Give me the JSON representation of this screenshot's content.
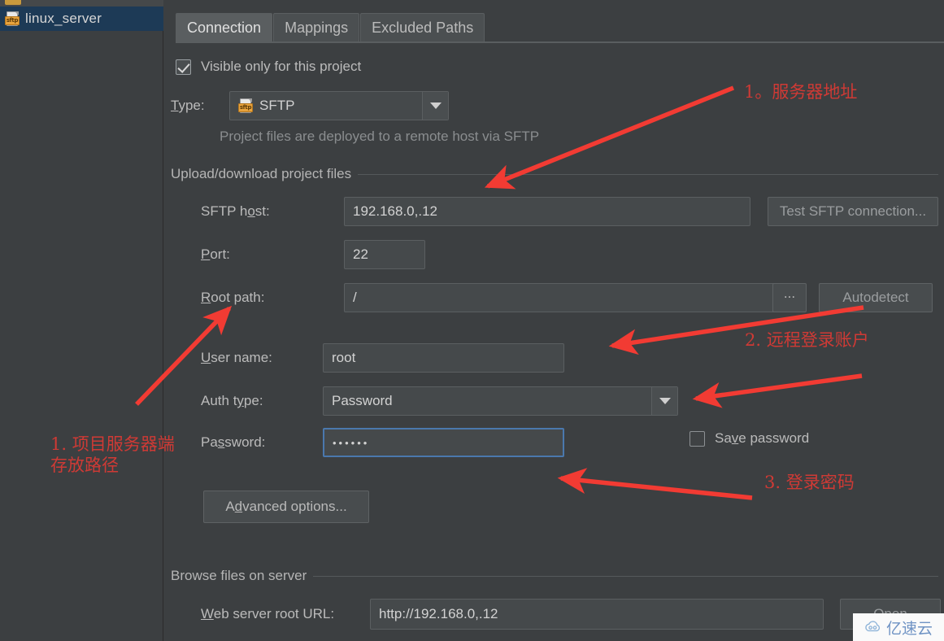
{
  "sidebar": {
    "server_item": {
      "label": "linux_server",
      "icon": "sftp-file-icon",
      "selected": true
    }
  },
  "tabs": [
    {
      "label": "Connection",
      "active": true
    },
    {
      "label": "Mappings",
      "active": false
    },
    {
      "label": "Excluded Paths",
      "active": false
    }
  ],
  "form": {
    "visible_only_checkbox": {
      "label": "Visible only for this project",
      "checked": true
    },
    "type": {
      "label": "Type:",
      "value": "SFTP",
      "icon": "sftp-file-icon"
    },
    "type_hint": "Project files are deployed to a remote host via SFTP",
    "upload_group_title": "Upload/download project files",
    "sftp_host": {
      "label": "SFTP host:",
      "value": "192.168.0,.12"
    },
    "test_connection_button": "Test SFTP connection...",
    "port": {
      "label": "Port:",
      "value": "22"
    },
    "root_path": {
      "label": "Root path:",
      "value": "/"
    },
    "browse_button": "...",
    "autodetect_button": "Autodetect",
    "user_name": {
      "label": "User name:",
      "value": "root"
    },
    "auth_type": {
      "label": "Auth type:",
      "value": "Password"
    },
    "password": {
      "label": "Password:",
      "value": "••••••",
      "focused": true
    },
    "save_password_checkbox": {
      "label": "Save password",
      "checked": false
    },
    "advanced_options_button": "Advanced options...",
    "browse_group_title": "Browse files on server",
    "web_server_root_url": {
      "label": "Web server root URL:",
      "value": "http://192.168.0,.12"
    },
    "open_button": "Open"
  },
  "annotations": [
    {
      "id": "anno-server-address",
      "text": "1。服务器地址"
    },
    {
      "id": "anno-remote-account",
      "text": "2. 远程登录账户"
    },
    {
      "id": "anno-login-password",
      "text": "3. 登录密码"
    },
    {
      "id": "anno-project-path",
      "text": "1. 项目服务器端\n存放路径"
    }
  ],
  "watermark": {
    "text": "亿速云"
  },
  "colors": {
    "background": "#3c3f41",
    "selection": "#1d3a56",
    "annotation_red": "#cf3a35",
    "arrow_red": "#f23b33",
    "focus_blue": "#4a78ad",
    "accent_orange": "#e8a33d"
  }
}
